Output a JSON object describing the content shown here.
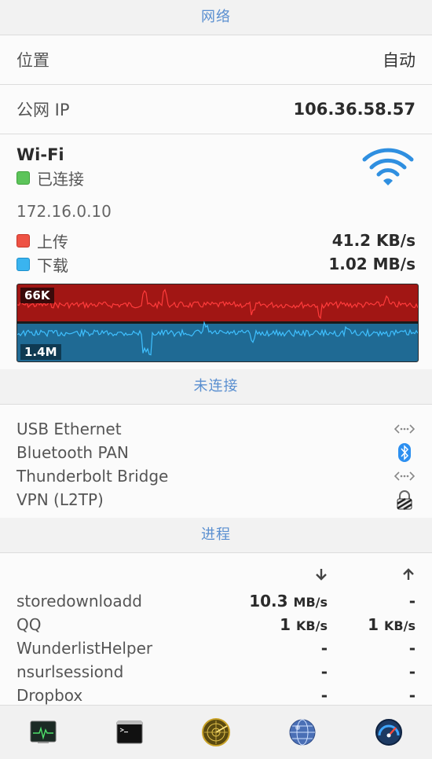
{
  "network": {
    "header": "网络",
    "location_label": "位置",
    "location_value": "自动",
    "public_ip_label": "公网 IP",
    "public_ip_value": "106.36.58.57"
  },
  "wifi": {
    "title": "Wi-Fi",
    "status": "已连接",
    "status_color": "#5cc45a",
    "local_ip": "172.16.0.10",
    "upload_label": "上传",
    "upload_rate": "41.2 KB/s",
    "upload_color": "#ee5244",
    "download_label": "下载",
    "download_rate": "1.02 MB/s",
    "download_color": "#3ab4ef",
    "graph": {
      "upload_peak_label": "66K",
      "download_peak_label": "1.4M"
    }
  },
  "disconnected": {
    "header": "未连接",
    "items": [
      {
        "name": "USB Ethernet",
        "icon": "ethernet-arrows-icon"
      },
      {
        "name": "Bluetooth PAN",
        "icon": "bluetooth-icon"
      },
      {
        "name": "Thunderbolt Bridge",
        "icon": "ethernet-arrows-icon"
      },
      {
        "name": "VPN (L2TP)",
        "icon": "vpn-lock-icon"
      }
    ]
  },
  "processes": {
    "header": "进程",
    "download_icon": "arrow-down-icon",
    "upload_icon": "arrow-up-icon",
    "rows": [
      {
        "name": "storedownloadd",
        "down": "10.3",
        "down_unit": "MB/s",
        "up": "-",
        "up_unit": ""
      },
      {
        "name": "QQ",
        "down": "1",
        "down_unit": "KB/s",
        "up": "1",
        "up_unit": "KB/s"
      },
      {
        "name": "WunderlistHelper",
        "down": "-",
        "down_unit": "",
        "up": "-",
        "up_unit": ""
      },
      {
        "name": "nsurlsessiond",
        "down": "-",
        "down_unit": "",
        "up": "-",
        "up_unit": ""
      },
      {
        "name": "Dropbox",
        "down": "-",
        "down_unit": "",
        "up": "-",
        "up_unit": ""
      }
    ]
  },
  "dock": {
    "items": [
      {
        "icon": "activity-monitor-icon"
      },
      {
        "icon": "terminal-icon"
      },
      {
        "icon": "network-radar-icon"
      },
      {
        "icon": "network-utility-icon"
      },
      {
        "icon": "speed-test-icon"
      }
    ]
  }
}
